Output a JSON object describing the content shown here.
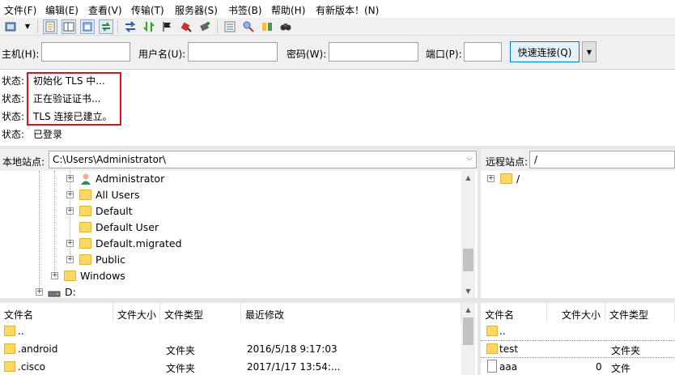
{
  "menu": [
    "文件(F)",
    "编辑(E)",
    "查看(V)",
    "传输(T)",
    "服务器(S)",
    "书签(B)",
    "帮助(H)",
    "有新版本！(N)"
  ],
  "toolbar": {
    "icons": [
      "site-manager-icon",
      "dropdown-arrow-icon",
      "toggle-log-icon",
      "toggle-local-tree-icon",
      "toggle-remote-tree-icon",
      "toggle-queue-icon",
      "refresh-icon",
      "process-queue-icon",
      "cancel-icon",
      "disconnect-icon",
      "reconnect-icon",
      "directory-listing-filter-icon",
      "sync-browse-icon",
      "compare-dirs-icon",
      "search-icon"
    ]
  },
  "quickconnect": {
    "host_label": "主机(H):",
    "user_label": "用户名(U):",
    "password_label": "密码(W):",
    "port_label": "端口(P):",
    "host_value": "",
    "user_value": "",
    "password_value": "",
    "port_value": "",
    "connect_label": "快速连接(Q)",
    "dropdown_glyph": "▼"
  },
  "log": [
    {
      "label": "状态:",
      "text": "初始化 TLS 中..."
    },
    {
      "label": "状态:",
      "text": "正在验证证书..."
    },
    {
      "label": "状态:",
      "text": "TLS 连接已建立。"
    },
    {
      "label": "状态:",
      "text": "已登录"
    }
  ],
  "local": {
    "site_label": "本地站点:",
    "path": "C:\\Users\\Administrator\\",
    "tree": [
      {
        "label": "Administrator",
        "icon": "user-folder-icon"
      },
      {
        "label": "All Users",
        "icon": "folder-icon"
      },
      {
        "label": "Default",
        "icon": "folder-icon"
      },
      {
        "label": "Default User",
        "icon": "folder-icon"
      },
      {
        "label": "Default.migrated",
        "icon": "folder-icon"
      },
      {
        "label": "Public",
        "icon": "folder-icon"
      },
      {
        "label": "Windows",
        "icon": "folder-icon"
      },
      {
        "label": "D:",
        "icon": "drive-icon"
      }
    ],
    "columns": [
      "文件名",
      "文件大小",
      "文件类型",
      "最近修改"
    ],
    "files": [
      {
        "name": "..",
        "size": "",
        "type": "",
        "modified": ""
      },
      {
        "name": ".android",
        "size": "",
        "type": "文件夹",
        "modified": "2016/5/18 9:17:03"
      },
      {
        "name": ".cisco",
        "size": "",
        "type": "文件夹",
        "modified": "2017/1/17 13:54:..."
      }
    ]
  },
  "remote": {
    "site_label": "远程站点:",
    "path": "/",
    "tree": [
      {
        "label": "/",
        "icon": "folder-icon"
      }
    ],
    "columns": [
      "文件名",
      "文件大小",
      "文件类型"
    ],
    "files": [
      {
        "name": "..",
        "size": "",
        "type": "",
        "icon": "folder-icon"
      },
      {
        "name": "test",
        "size": "",
        "type": "文件夹",
        "icon": "folder-icon"
      },
      {
        "name": "aaa",
        "size": "0",
        "type": "文件",
        "icon": "file-icon"
      }
    ]
  },
  "colors": {
    "highlight": "#e0101a",
    "connect_border": "#0078d7",
    "folder": "#ffd862"
  }
}
